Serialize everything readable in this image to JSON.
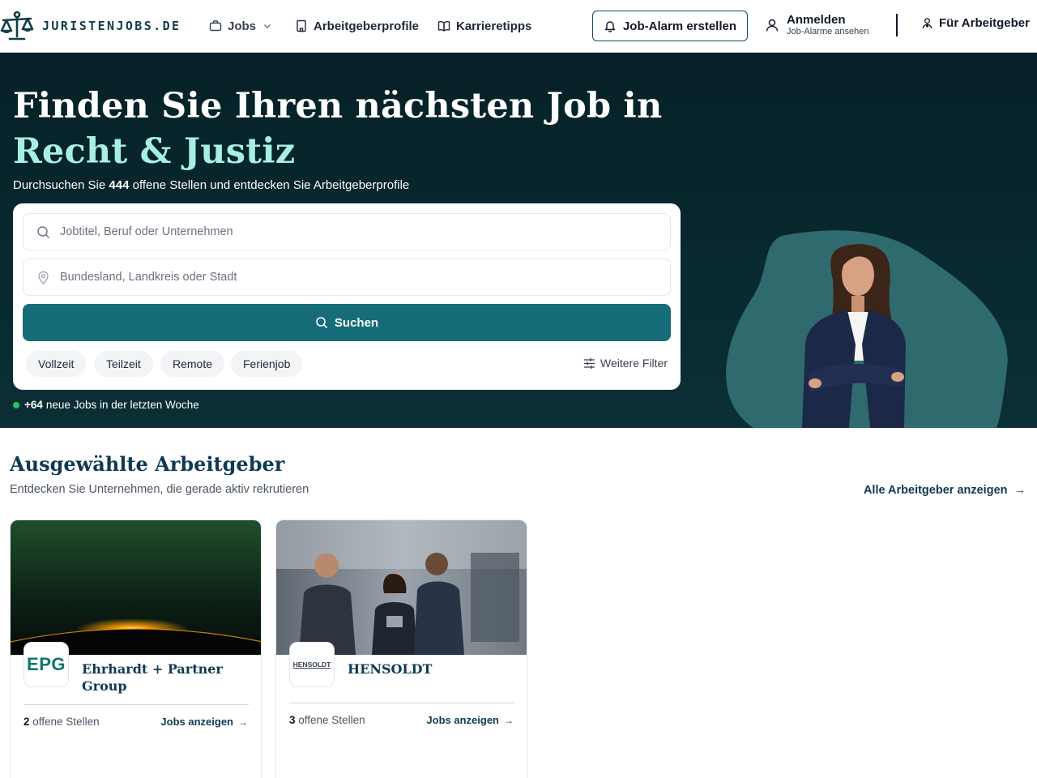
{
  "header": {
    "logo_text": "JURISTENJOBS.DE",
    "nav": {
      "jobs_label": "Jobs",
      "employer_profiles_label": "Arbeitgeberprofile",
      "career_tips_label": "Karrieretipps"
    },
    "job_alarm_label": "Job-Alarm erstellen",
    "login_label": "Anmelden",
    "login_sub": "Job-Alarme ansehen",
    "for_employers_label": "Für Arbeitgeber"
  },
  "hero": {
    "title_line1": "Finden Sie Ihren nächsten Job in",
    "title_line2": "Recht & Justiz",
    "subtitle_prefix": "Durchsuchen Sie ",
    "open_positions": "444",
    "subtitle_suffix": " offene Stellen und entdecken Sie Arbeitgeberprofile",
    "search": {
      "job_placeholder": "Jobtitel, Beruf oder Unternehmen",
      "job_value": "",
      "location_placeholder": "Bundesland, Landkreis oder Stadt",
      "location_value": "",
      "button_label": "Suchen"
    },
    "filters": [
      "Vollzeit",
      "Teilzeit",
      "Remote",
      "Ferienjob"
    ],
    "more_filters_label": "Weitere Filter",
    "new_jobs_count": "+64",
    "new_jobs_text": "neue Jobs in der letzten Woche"
  },
  "employers": {
    "title": "Ausgewählte Arbeitgeber",
    "subtitle": "Entdecken Sie Unternehmen, die gerade aktiv rekrutieren",
    "all_link": "Alle Arbeitgeber anzeigen",
    "cards": [
      {
        "logo_text": "EPG",
        "name": "Ehrhardt + Partner Group",
        "count": "2",
        "count_label": " offene Stellen",
        "jobs_link": "Jobs anzeigen"
      },
      {
        "logo_text": "HENSOLDT",
        "name": "HENSOLDT",
        "count": "3",
        "count_label": " offene Stellen",
        "jobs_link": "Jobs anzeigen"
      }
    ]
  },
  "colors": {
    "hero_bg": "#062127",
    "accent_teal": "#166c78",
    "title_accent": "#a7efe5",
    "heading_navy": "#0f3a52",
    "status_green": "#22c55e"
  },
  "icons": [
    "scales-logo-icon",
    "briefcase-icon",
    "chevron-down-icon",
    "building-icon",
    "book-icon",
    "bell-icon",
    "user-icon",
    "user-tie-icon",
    "search-icon",
    "map-pin-icon",
    "sliders-icon",
    "arrow-right-icon"
  ]
}
